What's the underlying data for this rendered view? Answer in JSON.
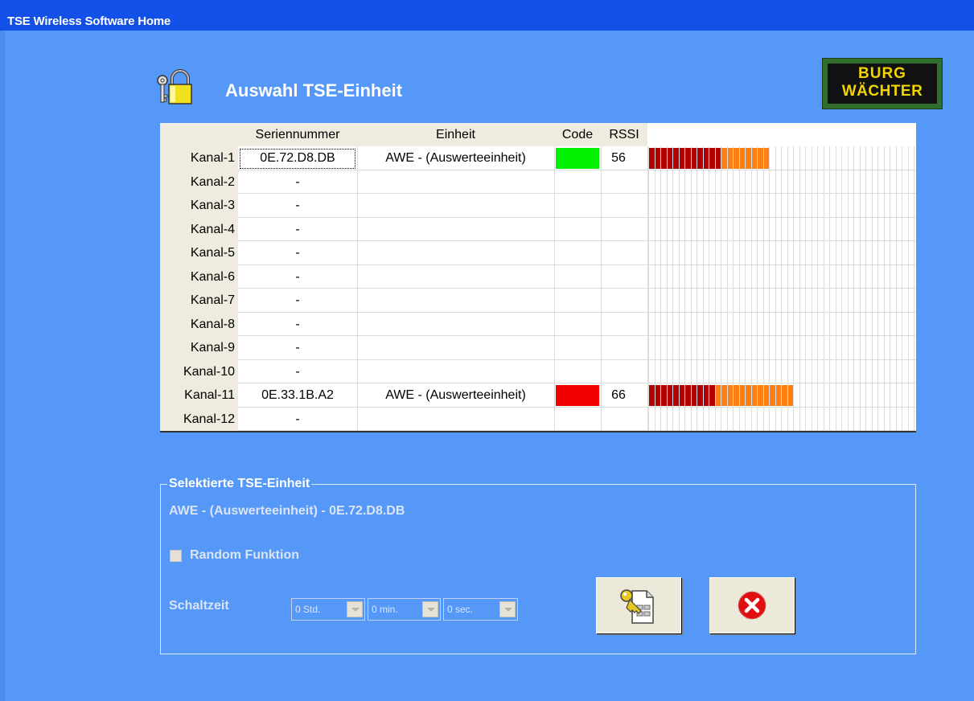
{
  "window": {
    "title": "TSE Wireless Software Home"
  },
  "header": {
    "title": "Auswahl TSE-Einheit",
    "logo_line1": "BURG",
    "logo_line2": "WÄCHTER"
  },
  "table": {
    "columns": {
      "serial": "Seriennummer",
      "unit": "Einheit",
      "code": "Code",
      "rssi": "RSSI"
    },
    "rows": [
      {
        "label": "Kanal-1",
        "serial": "0E.72.D8.DB",
        "unit": "AWE - (Auswerteeinheit)",
        "code_color": "#00f000",
        "rssi": "56",
        "bar_red": 12,
        "bar_orange": 8,
        "focused": true
      },
      {
        "label": "Kanal-2",
        "serial": "-",
        "unit": "",
        "code_color": "",
        "rssi": "",
        "bar_red": 0,
        "bar_orange": 0
      },
      {
        "label": "Kanal-3",
        "serial": "-",
        "unit": "",
        "code_color": "",
        "rssi": "",
        "bar_red": 0,
        "bar_orange": 0
      },
      {
        "label": "Kanal-4",
        "serial": "-",
        "unit": "",
        "code_color": "",
        "rssi": "",
        "bar_red": 0,
        "bar_orange": 0
      },
      {
        "label": "Kanal-5",
        "serial": "-",
        "unit": "",
        "code_color": "",
        "rssi": "",
        "bar_red": 0,
        "bar_orange": 0
      },
      {
        "label": "Kanal-6",
        "serial": "-",
        "unit": "",
        "code_color": "",
        "rssi": "",
        "bar_red": 0,
        "bar_orange": 0
      },
      {
        "label": "Kanal-7",
        "serial": "-",
        "unit": "",
        "code_color": "",
        "rssi": "",
        "bar_red": 0,
        "bar_orange": 0
      },
      {
        "label": "Kanal-8",
        "serial": "-",
        "unit": "",
        "code_color": "",
        "rssi": "",
        "bar_red": 0,
        "bar_orange": 0
      },
      {
        "label": "Kanal-9",
        "serial": "-",
        "unit": "",
        "code_color": "",
        "rssi": "",
        "bar_red": 0,
        "bar_orange": 0
      },
      {
        "label": "Kanal-10",
        "serial": "-",
        "unit": "",
        "code_color": "",
        "rssi": "",
        "bar_red": 0,
        "bar_orange": 0
      },
      {
        "label": "Kanal-11",
        "serial": "0E.33.1B.A2",
        "unit": "AWE - (Auswerteeinheit)",
        "code_color": "#f00000",
        "rssi": "66",
        "bar_red": 11,
        "bar_orange": 13
      },
      {
        "label": "Kanal-12",
        "serial": "-",
        "unit": "",
        "code_color": "",
        "rssi": "",
        "bar_red": 0,
        "bar_orange": 0
      }
    ],
    "bar_colors": {
      "red": "#b00000",
      "orange": "#ff8010"
    }
  },
  "selected": {
    "group_title": "Selektierte TSE-Einheit",
    "unit_text": "AWE - (Auswerteeinheit) - 0E.72.D8.DB",
    "random_label": "Random Funktion",
    "schaltzeit_label": "Schaltzeit",
    "hours": "0 Std.",
    "minutes": "0 min.",
    "seconds": "0 sec."
  },
  "colors": {
    "background": "#5598f8",
    "titlebar": "#1250e8"
  }
}
